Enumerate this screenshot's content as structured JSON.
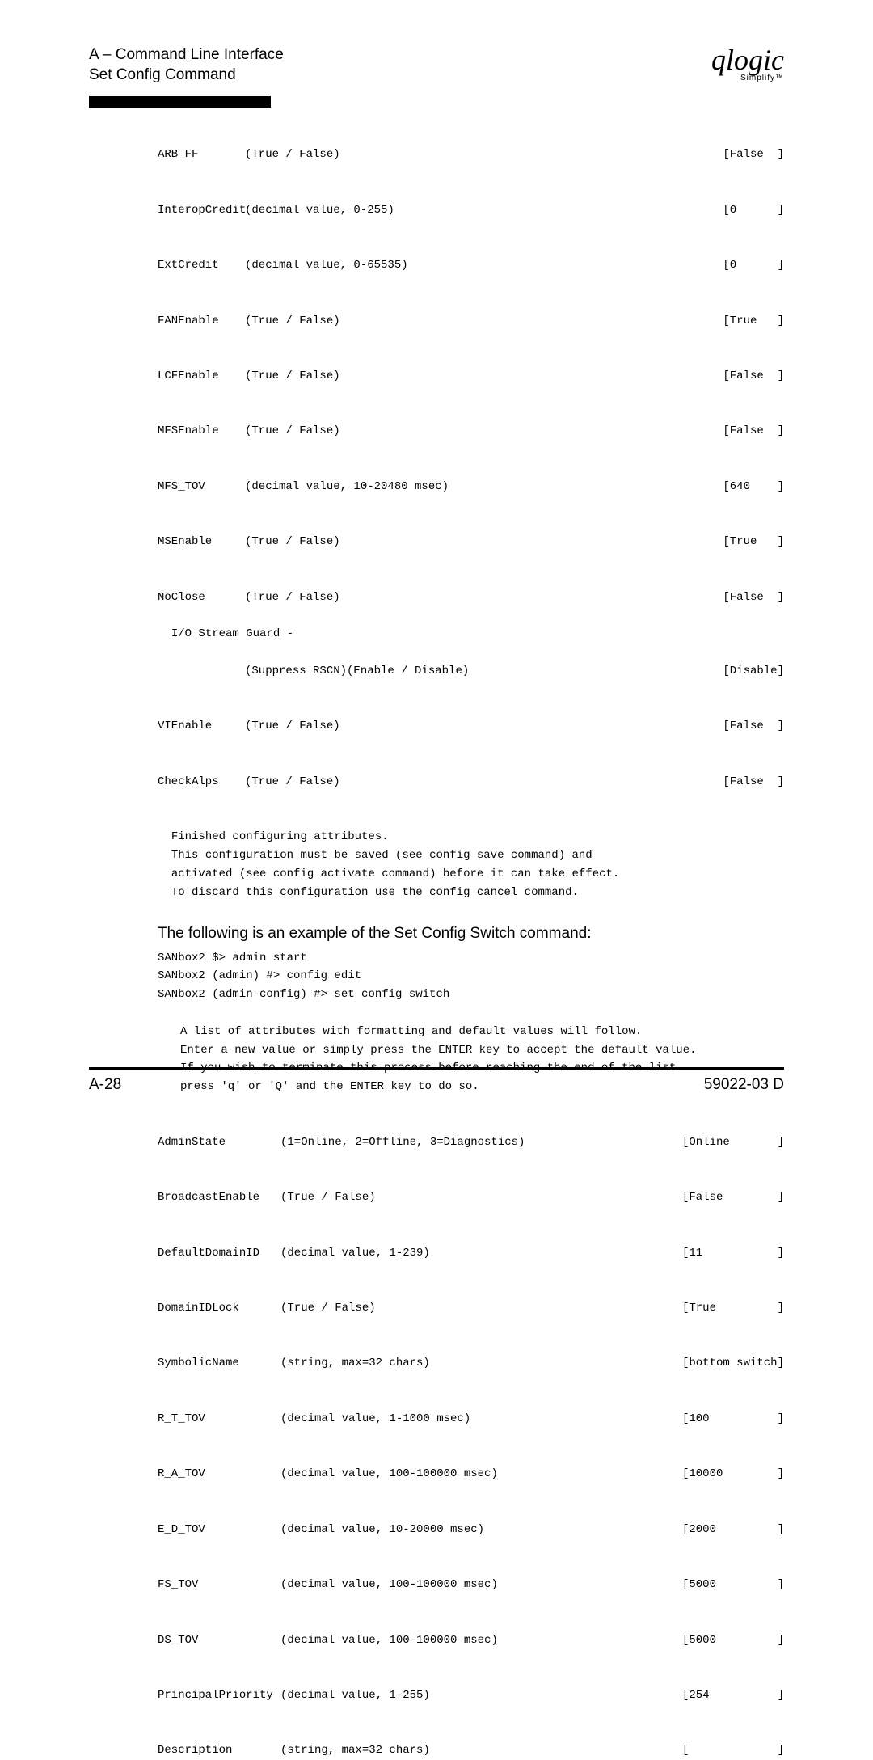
{
  "header": {
    "line1": "A – Command Line Interface",
    "line2": "Set Config Command"
  },
  "logo": {
    "script": "qlogic",
    "simplify": "Simplify™"
  },
  "port_attrs": [
    {
      "name": "ARB_FF",
      "hint": "(True / False)",
      "value": "[False  ]"
    },
    {
      "name": "InteropCredit",
      "hint": "(decimal value, 0-255)",
      "value": "[0      ]"
    },
    {
      "name": "ExtCredit",
      "hint": "(decimal value, 0-65535)",
      "value": "[0      ]"
    },
    {
      "name": "FANEnable",
      "hint": "(True / False)",
      "value": "[True   ]"
    },
    {
      "name": "LCFEnable",
      "hint": "(True / False)",
      "value": "[False  ]"
    },
    {
      "name": "MFSEnable",
      "hint": "(True / False)",
      "value": "[False  ]"
    },
    {
      "name": "MFS_TOV",
      "hint": "(decimal value, 10-20480 msec)",
      "value": "[640    ]"
    },
    {
      "name": "MSEnable",
      "hint": "(True / False)",
      "value": "[True   ]"
    },
    {
      "name": "NoClose",
      "hint": "(True / False)",
      "value": "[False  ]"
    }
  ],
  "ioguard_label": "I/O Stream Guard -",
  "ioguard": {
    "hint": "(Suppress RSCN)(Enable / Disable)",
    "value": "[Disable]"
  },
  "port_attrs_tail": [
    {
      "name": "VIEnable",
      "hint": "(True / False)",
      "value": "[False  ]"
    },
    {
      "name": "CheckAlps",
      "hint": "(True / False)",
      "value": "[False  ]"
    }
  ],
  "finish_msgs": [
    "Finished configuring attributes.",
    "This configuration must be saved (see config save command) and",
    "activated (see config activate command) before it can take effect.",
    "To discard this configuration use the config cancel command."
  ],
  "section_intro": "The following is an example of the Set Config Switch command:",
  "cmds": [
    "SANbox2 $> admin start",
    "SANbox2 (admin) #> config edit",
    "SANbox2 (admin-config) #> set config switch"
  ],
  "instr": [
    "A list of attributes with formatting and default values will follow.",
    "Enter a new value or simply press the ENTER key to accept the default value.",
    "If you wish to terminate this process before reaching the end of the list",
    "press 'q' or 'Q' and the ENTER key to do so."
  ],
  "switch_attrs": [
    {
      "name": "AdminState",
      "hint": "(1=Online, 2=Offline, 3=Diagnostics)",
      "value": "[Online       ]"
    },
    {
      "name": "BroadcastEnable",
      "hint": "(True / False)",
      "value": "[False        ]"
    },
    {
      "name": "DefaultDomainID",
      "hint": "(decimal value, 1-239)",
      "value": "[11           ]"
    },
    {
      "name": "DomainIDLock",
      "hint": "(True / False)",
      "value": "[True         ]"
    },
    {
      "name": "SymbolicName",
      "hint": "(string, max=32 chars)",
      "value": "[bottom switch]"
    },
    {
      "name": "R_T_TOV",
      "hint": "(decimal value, 1-1000 msec)",
      "value": "[100          ]"
    },
    {
      "name": "R_A_TOV",
      "hint": "(decimal value, 100-100000 msec)",
      "value": "[10000        ]"
    },
    {
      "name": "E_D_TOV",
      "hint": "(decimal value, 10-20000 msec)",
      "value": "[2000         ]"
    },
    {
      "name": "FS_TOV",
      "hint": "(decimal value, 100-100000 msec)",
      "value": "[5000         ]"
    },
    {
      "name": "DS_TOV",
      "hint": "(decimal value, 100-100000 msec)",
      "value": "[5000         ]"
    },
    {
      "name": "PrincipalPriority",
      "hint": "(decimal value, 1-255)",
      "value": "[254          ]"
    },
    {
      "name": "Description",
      "hint": "(string, max=32 chars)",
      "value": "[             ]"
    }
  ],
  "footer": {
    "left": "A-28",
    "right": "59022-03  D"
  }
}
